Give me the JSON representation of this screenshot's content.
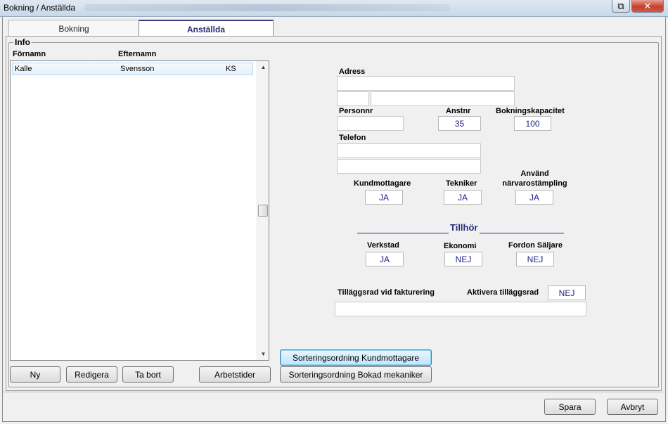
{
  "window": {
    "title": "Bokning / Anställda",
    "restore_glyph": "⧉",
    "close_glyph": "✕"
  },
  "tabs": [
    {
      "label": "Bokning"
    },
    {
      "label": "Anställda"
    }
  ],
  "info": {
    "group_title": "Info",
    "columns": [
      "Förnamn",
      "Efternamn"
    ],
    "rows": [
      {
        "first": "Kalle",
        "last": "Svensson",
        "initials": "KS"
      }
    ],
    "scroll_up": "▲",
    "scroll_down": "▼"
  },
  "form": {
    "adress_label": "Adress",
    "personnr_label": "Personnr",
    "anstnr_label": "Anstnr",
    "anstnr_value": "35",
    "bokningskapacitet_label": "Bokningskapacitet",
    "bokningskapacitet_value": "100",
    "telefon_label": "Telefon",
    "kundmottagare_label": "Kundmottagare",
    "kundmottagare_value": "JA",
    "tekniker_label": "Tekniker",
    "tekniker_value": "JA",
    "narvaro_label_1": "Använd",
    "narvaro_label_2": "närvarostämpling",
    "narvaro_value": "JA",
    "tillhor_label": "Tillhör",
    "verkstad_label": "Verkstad",
    "verkstad_value": "JA",
    "ekonomi_label": "Ekonomi",
    "ekonomi_value": "NEJ",
    "fordon_label": "Fordon Säljare",
    "fordon_value": "NEJ",
    "tillaggsrad_label": "Tilläggsrad vid fakturering",
    "aktivera_label": "Aktivera tilläggsrad",
    "aktivera_value": "NEJ"
  },
  "buttons": {
    "ny": "Ny",
    "redigera": "Redigera",
    "ta_bort": "Ta bort",
    "arbetstider": "Arbetstider",
    "sort_kund": "Sorteringsordning Kundmottagare",
    "sort_mek": "Sorteringsordning Bokad mekaniker",
    "spara": "Spara",
    "avbryt": "Avbryt"
  }
}
